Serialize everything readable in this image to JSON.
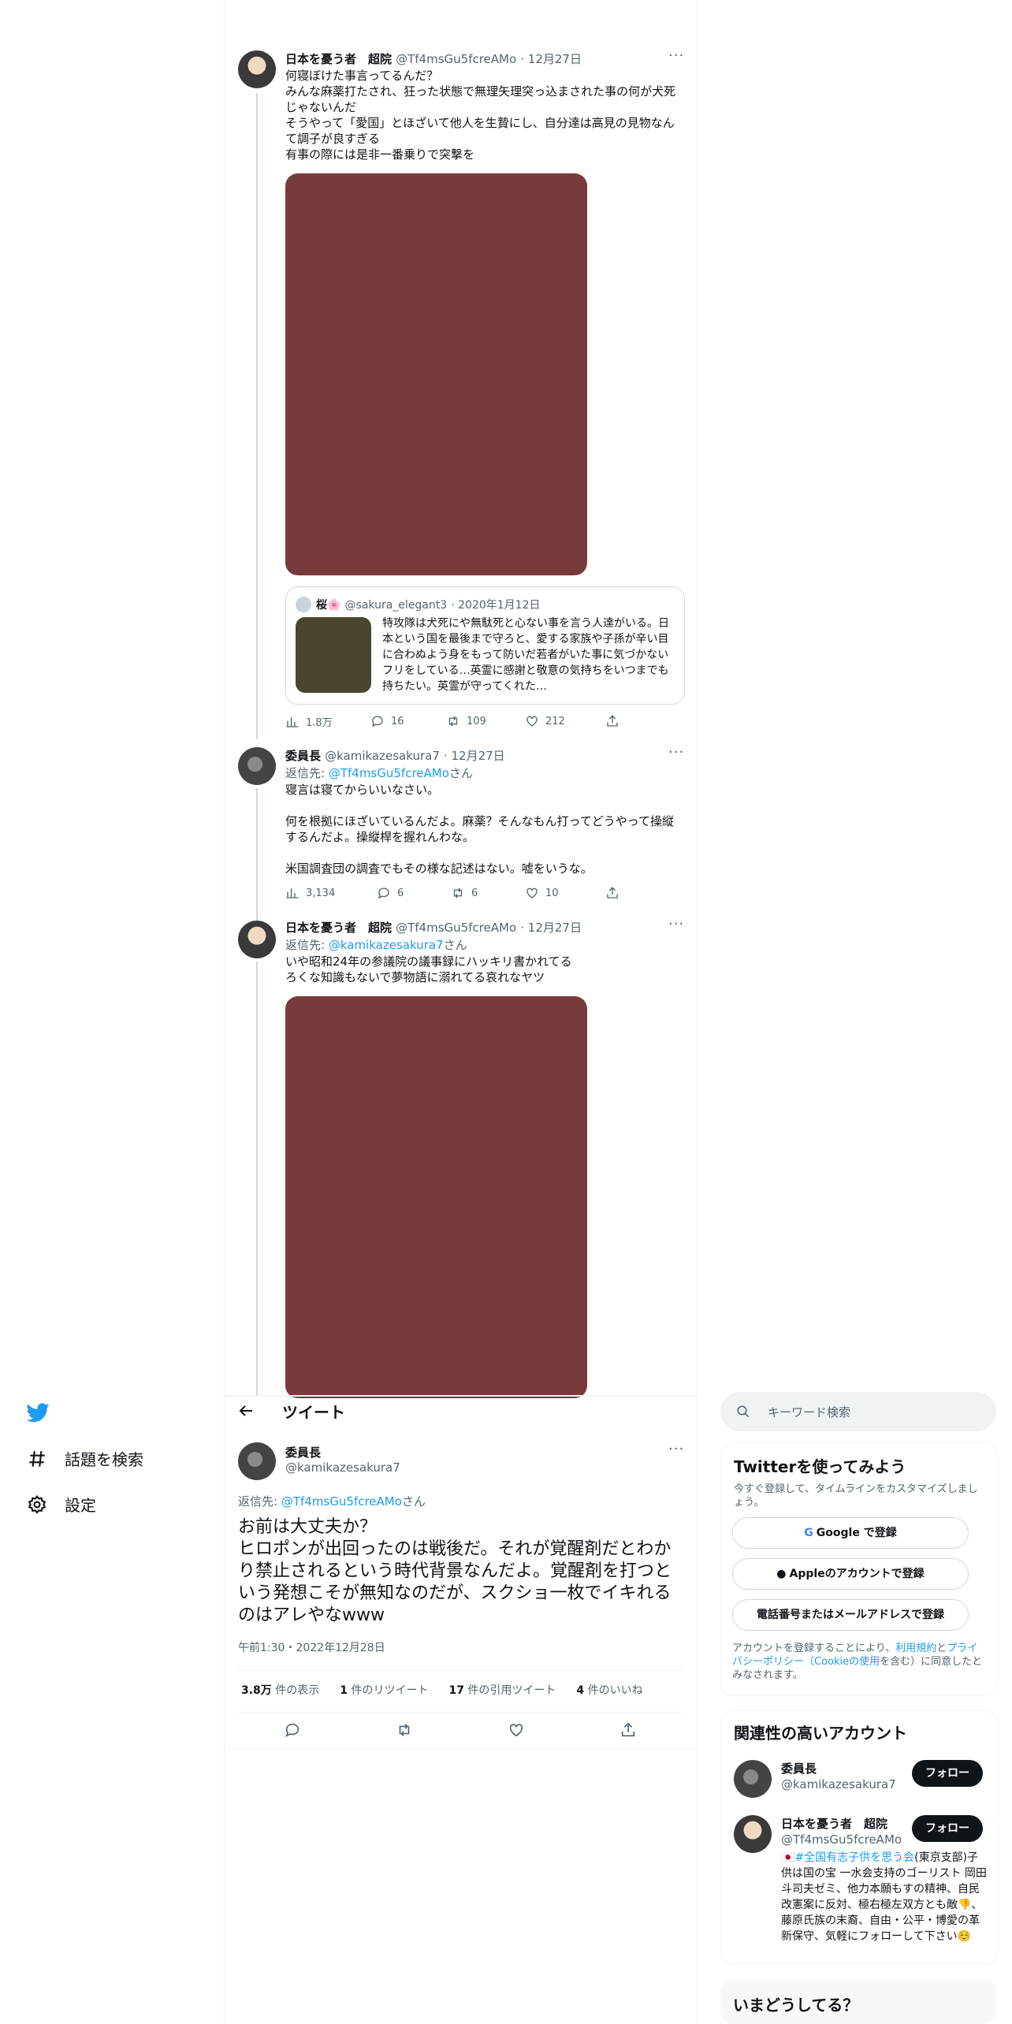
{
  "nav": {
    "explore_label": "話題を検索",
    "settings_label": "設定"
  },
  "header": {
    "title": "ツイート"
  },
  "thread": [
    {
      "name": "日本を憂う者　超院",
      "handle": "@Tf4msGu5fcreAMo",
      "date": "· 12月27日",
      "text": "何寝ぼけた事言ってるんだ？\nみんな麻薬打たされ、狂った状態で無理矢理突っ込まされた事の何が犬死じゃないんだ\nそうやって「愛国」とほざいて他人を生贄にし、自分達は高見の見物なんて調子が良すぎる\n有事の際には是非一番乗りで突撃を",
      "quote": {
        "name": "桜🌸",
        "handle": "@sakura_elegant3",
        "date": "· 2020年1月12日",
        "text": "特攻隊は犬死にや無駄死と心ない事を言う人達がいる。日本という国を最後まで守ろと、愛する家族や子孫が辛い目に合わぬよう身をもって防いだ若者がいた事に気づかないフリをしている…英霊に感謝と敬意の気持ちをいつまでも持ちたい。英霊が守ってくれた…"
      },
      "views": "1.8万",
      "replies": "16",
      "retweets": "109",
      "likes": "212"
    },
    {
      "name": "委員長",
      "handle": "@kamikazesakura7",
      "date": "· 12月27日",
      "reply_prefix": "返信先: ",
      "reply_to": "@Tf4msGu5fcreAMo",
      "reply_suffix": "さん",
      "text": "寝言は寝てからいいなさい。\n\n何を根拠にほざいているんだよ。麻薬？そんなもん打ってどうやって操縦するんだよ。操縦桿を握れんわな。\n\n米国調査団の調査でもその様な記述はない。嘘をいうな。",
      "views": "3,134",
      "replies": "6",
      "retweets": "6",
      "likes": "10"
    },
    {
      "name": "日本を憂う者　超院",
      "handle": "@Tf4msGu5fcreAMo",
      "date": "· 12月27日",
      "reply_prefix": "返信先: ",
      "reply_to": "@kamikazesakura7",
      "reply_suffix": "さん",
      "text": "いや昭和24年の参議院の議事録にハッキリ書かれてる\nろくな知識もないで夢物語に溺れてる哀れなヤツ"
    }
  ],
  "main_tweet": {
    "name": "委員長",
    "handle": "@kamikazesakura7",
    "reply_prefix": "返信先: ",
    "reply_to": "@Tf4msGu5fcreAMo",
    "reply_suffix": "さん",
    "text": "お前は大丈夫か？\nヒロポンが出回ったのは戦後だ。それが覚醒剤だとわかり禁止されるという時代背景なんだよ。覚醒剤を打つという発想こそが無知なのだが、スクショ一枚でイキれるのはアレやなwww",
    "timestamp": "午前1:30・2022年12月28日",
    "stats": {
      "views_num": "3.8万",
      "views_label": " 件の表示",
      "retweets_num": "1",
      "retweets_label": " 件のリツイート",
      "quotes_num": "17",
      "quotes_label": " 件の引用ツイート",
      "likes_num": "4",
      "likes_label": " 件のいいね"
    }
  },
  "search": {
    "placeholder": "キーワード検索"
  },
  "signup": {
    "title": "Twitterを使ってみよう",
    "subtitle": "今すぐ登録して、タイムラインをカスタマイズしましょう。",
    "google_label": "Google で登録",
    "apple_label": "Appleのアカウントで登録",
    "phone_label": "電話番号またはメールアドレスで登録",
    "terms_prefix": "アカウントを登録することにより、",
    "terms_link1": "利用規約",
    "terms_and": "と",
    "terms_link2": "プライバシーポリシー",
    "terms_link3": "（Cookieの使用",
    "terms_suffix": "を含む）に同意したとみなされます。"
  },
  "related": {
    "title": "関連性の高いアカウント",
    "accounts": [
      {
        "name": "委員長",
        "handle": "@kamikazesakura7",
        "follow_label": "フォロー"
      },
      {
        "name": "日本を憂う者　超院",
        "handle": "@Tf4msGu5fcreAMo",
        "follow_label": "フォロー",
        "bio_flag": "🇯🇵",
        "bio_link": "#全国有志子供を思う会",
        "bio_text": "(東京支部)子供は国の宝 一水会支持のゴーリスト 岡田斗司夫ゼミ、他力本願もすの精神、自民改憲案に反対、極右極左双方とも敵👎、藤原氏族の末裔、自由・公平・博愛の革新保守、気軽にフォローして下さい☺️"
      }
    ]
  },
  "trends": {
    "title": "いまどうしてる？"
  },
  "colors": {
    "accent": "#1d9bf0",
    "image_placeholder": "#773b3b",
    "quote_thumb": "#4a452e"
  }
}
